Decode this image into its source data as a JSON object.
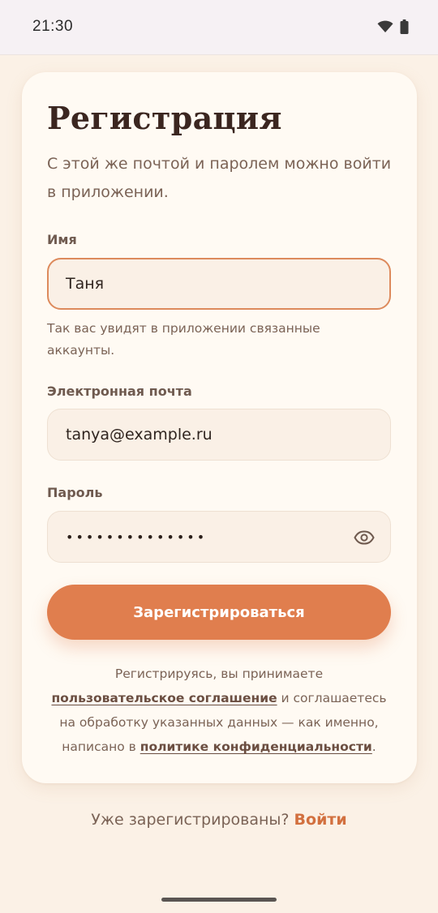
{
  "status_bar": {
    "time": "21:30",
    "icons": [
      "wifi-icon",
      "battery-icon"
    ]
  },
  "form": {
    "title": "Регистрация",
    "subtitle": "С этой же почтой и паролем можно войти в приложении.",
    "name": {
      "label": "Имя",
      "value": "Таня",
      "helper": "Так вас увидят в приложении связанные аккаунты."
    },
    "email": {
      "label": "Электронная почта",
      "value": "tanya@example.ru"
    },
    "password": {
      "label": "Пароль",
      "masked_value": "••••••••••••••"
    },
    "submit_label": "Зарегистрироваться",
    "legal": {
      "part1": "Регистрируясь, вы принимаете ",
      "terms_link": "пользовательское соглашение",
      "part2": " и соглашаетесь на обработку указанных данных — как именно, написано в ",
      "privacy_link": "политике конфиденциальности",
      "part3": "."
    }
  },
  "footer": {
    "prompt": "Уже зарегистрированы? ",
    "login_link": "Войти"
  },
  "colors": {
    "accent": "#e07e4e",
    "background": "#fbf1e6",
    "card": "#fffaf3",
    "focus_border": "#dd8a5c"
  }
}
